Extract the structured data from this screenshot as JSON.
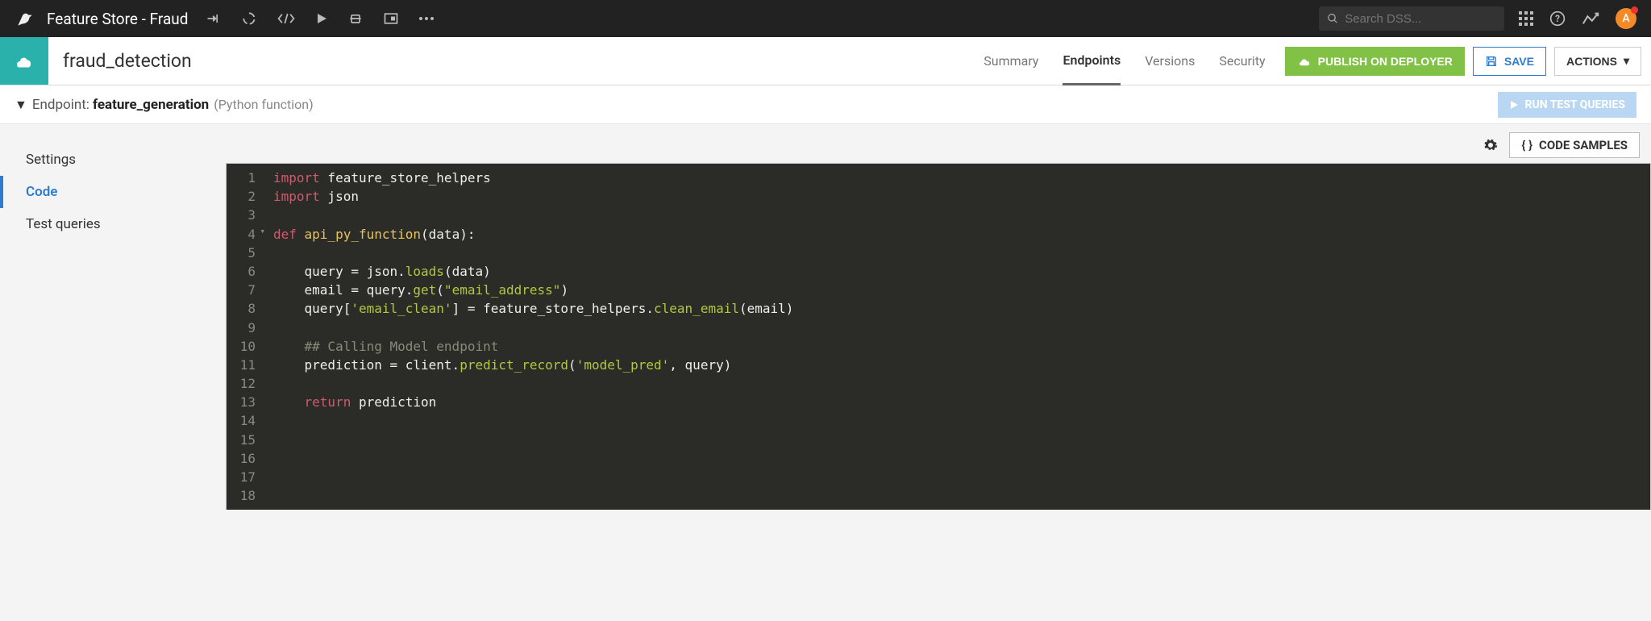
{
  "topbar": {
    "project_name": "Feature Store - Fraud",
    "search_placeholder": "Search DSS...",
    "avatar_letter": "A"
  },
  "subhead": {
    "title": "fraud_detection",
    "tabs": {
      "summary": "Summary",
      "endpoints": "Endpoints",
      "versions": "Versions",
      "security": "Security"
    },
    "publish_label": "PUBLISH ON DEPLOYER",
    "save_label": "SAVE",
    "actions_label": "ACTIONS"
  },
  "endpoint": {
    "label": "Endpoint:",
    "name": "feature_generation",
    "kind": "(Python function)",
    "run_label": "RUN TEST QUERIES"
  },
  "sidebar": {
    "settings": "Settings",
    "code": "Code",
    "test_queries": "Test queries"
  },
  "editor_toolbar": {
    "code_samples_label": "CODE SAMPLES"
  },
  "code": {
    "line_count": 18,
    "lines": {
      "l1_kw": "import",
      "l1_rest": " feature_store_helpers",
      "l2_kw": "import",
      "l2_rest": " json",
      "l4_kw": "def ",
      "l4_fn": "api_py_function",
      "l4_rest": "(data):",
      "l6": "    query = json.",
      "l6_call": "loads",
      "l6_rest": "(data)",
      "l7": "    email = query.",
      "l7_call": "get",
      "l7_rest": "(",
      "l7_str": "\"email_address\"",
      "l7_close": ")",
      "l8": "    query[",
      "l8_str": "'email_clean'",
      "l8_mid": "] = feature_store_helpers.",
      "l8_call": "clean_email",
      "l8_rest": "(email)",
      "l10": "    ",
      "l10_cm": "## Calling Model endpoint",
      "l11": "    prediction = client.",
      "l11_call": "predict_record",
      "l11_rest": "(",
      "l11_str": "'model_pred'",
      "l11_close": ", query)",
      "l13": "    ",
      "l13_kw": "return",
      "l13_rest": " prediction"
    }
  }
}
